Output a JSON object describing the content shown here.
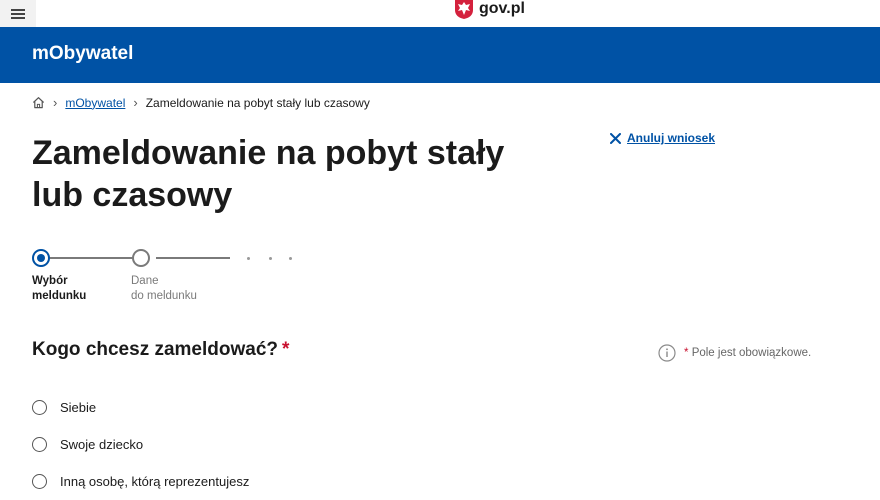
{
  "topbar": {
    "logo_text": "gov.pl"
  },
  "header": {
    "app_name": "mObywatel"
  },
  "breadcrumb": {
    "items": [
      "mObywatel",
      "Zameldowanie na pobyt stały lub czasowy"
    ]
  },
  "page": {
    "title": "Zameldowanie na pobyt stały lub czasowy",
    "cancel_label": "Anuluj wniosek"
  },
  "stepper": {
    "steps": [
      {
        "line1": "Wybór",
        "line2": "meldunku",
        "state": "active"
      },
      {
        "line1": "Dane",
        "line2": "do meldunku",
        "state": "inactive"
      }
    ]
  },
  "form": {
    "question": "Kogo chcesz zameldować?",
    "required_mark": "*",
    "required_note": "Pole jest obowiązkowe.",
    "options": [
      "Siebie",
      "Swoje dziecko",
      "Inną osobę, którą reprezentujesz"
    ]
  },
  "colors": {
    "brand_blue": "#0052a5",
    "required_red": "#c8102e"
  }
}
